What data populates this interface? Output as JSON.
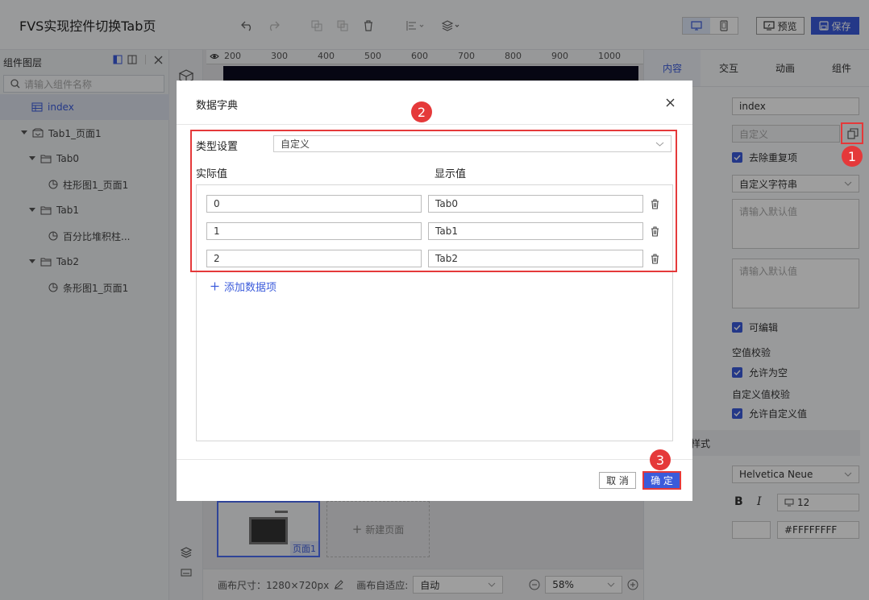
{
  "app": {
    "title": "FVS实现控件切换Tab页"
  },
  "toolbar": {
    "preview_label": "预览",
    "save_label": "保存"
  },
  "layers_panel": {
    "title": "组件图层",
    "search_placeholder": "请输入组件名称",
    "items": [
      {
        "label": "index",
        "type": "table",
        "selected": true
      },
      {
        "label": "Tab1_页面1",
        "type": "tab-container"
      },
      {
        "label": "Tab0",
        "type": "folder"
      },
      {
        "label": "柱形图1_页面1",
        "type": "chart"
      },
      {
        "label": "Tab1",
        "type": "folder"
      },
      {
        "label": "百分比堆积柱...",
        "type": "chart"
      },
      {
        "label": "Tab2",
        "type": "folder"
      },
      {
        "label": "条形图1_页面1",
        "type": "chart"
      }
    ]
  },
  "ruler": {
    "ticks": [
      "200",
      "300",
      "400",
      "500",
      "600",
      "700",
      "800",
      "900",
      "1000"
    ]
  },
  "pages": {
    "page_label": "页面1",
    "new_page_label": "新建页面"
  },
  "bottom_bar": {
    "canvas_size_label": "画布尺寸：1280×720px",
    "adapt_label": "画布自适应:",
    "adapt_value": "自动",
    "zoom_value": "58%"
  },
  "right_panel": {
    "tabs": [
      "内容",
      "交互",
      "动画",
      "组件"
    ],
    "active_tab": "内容",
    "field_name": "index",
    "dict_placeholder": "自定义",
    "dedupe_label": "去除重复项",
    "string_select": "自定义字符串",
    "default_placeholder_1": "请输入默认值",
    "default_placeholder_2": "请输入默认值",
    "editable_label": "可编辑",
    "empty_check_title": "空值校验",
    "allow_empty_label": "允许为空",
    "custom_check_title": "自定义值校验",
    "allow_custom_label": "允许自定义值",
    "style_section": "容样式",
    "font_family": "Helvetica Neue",
    "bold_label": "B",
    "italic_label": "I",
    "font_size": "12",
    "color_value": "#FFFFFFFF"
  },
  "modal": {
    "title": "数据字典",
    "type_label": "类型设置",
    "type_value": "自定义",
    "actual_label": "实际值",
    "display_label": "显示值",
    "rows": [
      {
        "actual": "0",
        "display": "Tab0"
      },
      {
        "actual": "1",
        "display": "Tab1"
      },
      {
        "actual": "2",
        "display": "Tab2"
      }
    ],
    "add_label": "添加数据项",
    "cancel_label": "取 消",
    "ok_label": "确 定"
  },
  "callouts": [
    "1",
    "2",
    "3"
  ],
  "colors": {
    "accent": "#3b5bdb",
    "callout": "#e5393a"
  }
}
